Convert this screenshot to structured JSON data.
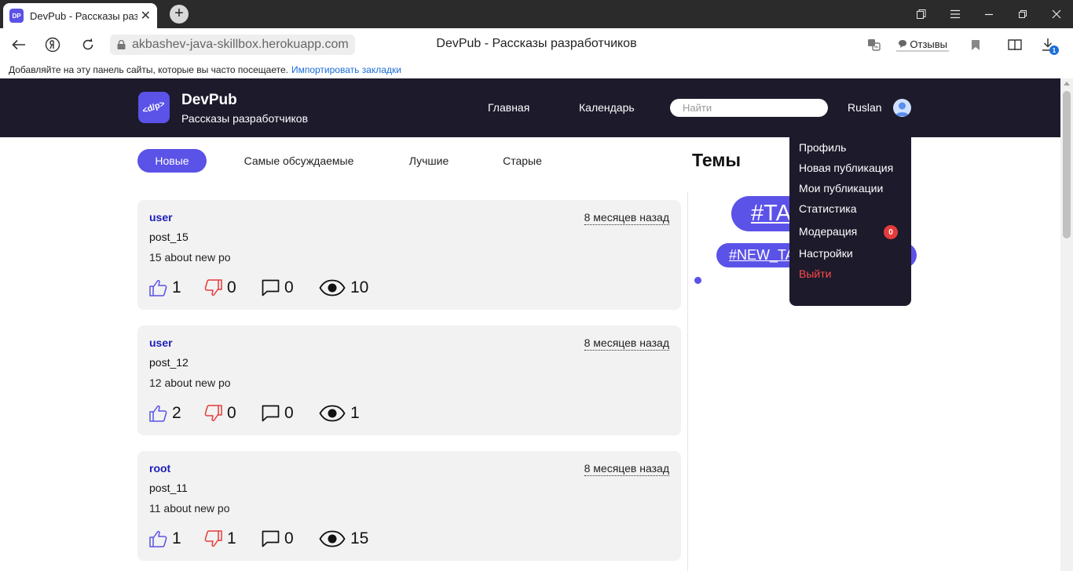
{
  "browser": {
    "tab_title": "DevPub - Рассказы разработчиков",
    "tab_favicon": "DP",
    "url": "akbashev-java-skillbox.herokuapp.com",
    "page_title": "DevPub - Рассказы разработчиков",
    "reviews_label": "Отзывы",
    "download_badge": "1",
    "bookmarks_hint": "Добавляйте на эту панель сайты, которые вы часто посещаете.",
    "bookmarks_import": "Импортировать закладки"
  },
  "header": {
    "logo_text": "<d/p>",
    "brand": "DevPub",
    "tagline": "Рассказы разработчиков",
    "nav": [
      "Главная",
      "Календарь"
    ],
    "search_placeholder": "Найти",
    "user_name": "Ruslan"
  },
  "filters": [
    {
      "label": "Новые",
      "active": true
    },
    {
      "label": "Самые обсуждаемые",
      "active": false
    },
    {
      "label": "Лучшие",
      "active": false
    },
    {
      "label": "Старые",
      "active": false
    }
  ],
  "posts": [
    {
      "author": "user",
      "time": "8 месяцев назад",
      "title": "post_15",
      "text": "15 about new po",
      "likes": "1",
      "dislikes": "0",
      "comments": "0",
      "views": "10"
    },
    {
      "author": "user",
      "time": "8 месяцев назад",
      "title": "post_12",
      "text": "12 about new po",
      "likes": "2",
      "dislikes": "0",
      "comments": "0",
      "views": "1"
    },
    {
      "author": "root",
      "time": "8 месяцев назад",
      "title": "post_11",
      "text": "11 about new po",
      "likes": "1",
      "dislikes": "1",
      "comments": "0",
      "views": "15"
    }
  ],
  "sidebar": {
    "title": "Темы",
    "tags": [
      "#TAG",
      "#NEW_TAG"
    ]
  },
  "user_menu": {
    "items": [
      "Профиль",
      "Новая публикация",
      "Мои публикации",
      "Статистика",
      "Модерация",
      "Настройки"
    ],
    "moderation_count": "0",
    "logout": "Выйти"
  },
  "colors": {
    "accent": "#5b52e8",
    "header_bg": "#1c1a2b",
    "like": "#5b52e8",
    "dislike": "#e63b3b",
    "logout": "#ff4a4a"
  }
}
